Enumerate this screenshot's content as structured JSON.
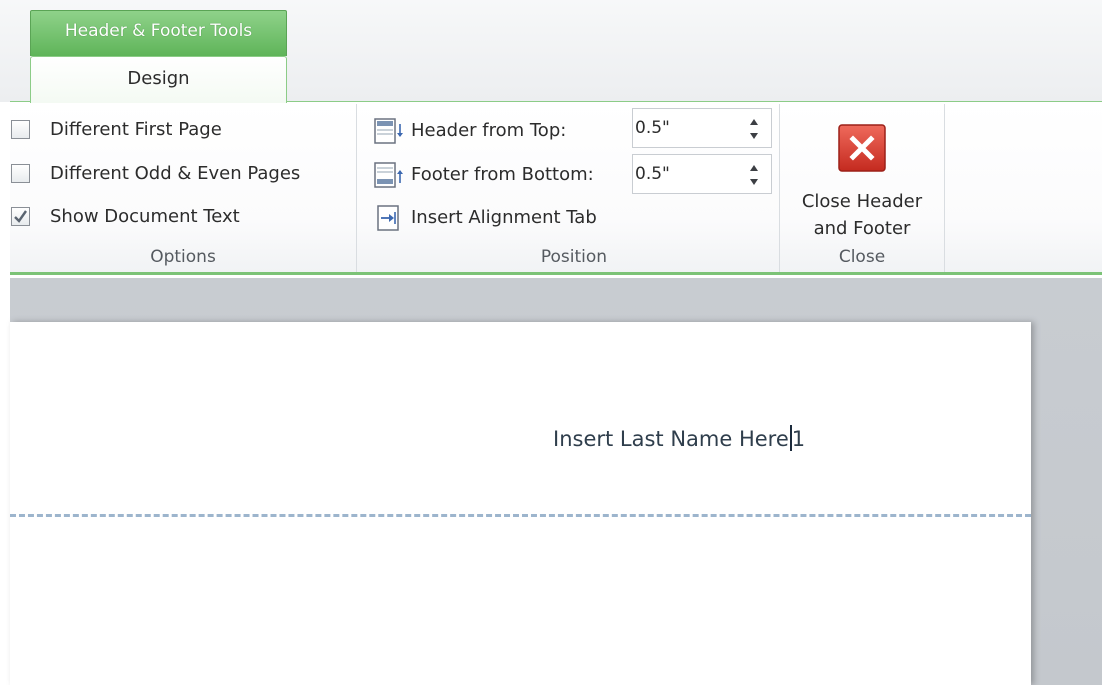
{
  "contextual_tab": {
    "title": "Header & Footer Tools"
  },
  "tabs": [
    {
      "label": "Design",
      "selected": true
    }
  ],
  "options_group": {
    "label": "Options",
    "items": [
      {
        "label": "Different First Page",
        "checked": false
      },
      {
        "label": "Different Odd & Even Pages",
        "checked": false
      },
      {
        "label": "Show Document Text",
        "checked": true
      }
    ]
  },
  "position_group": {
    "label": "Position",
    "header_from_top": {
      "label": "Header from Top:",
      "value": "0.5\""
    },
    "footer_from_bottom": {
      "label": "Footer from Bottom:",
      "value": "0.5\""
    },
    "insert_alignment_tab": {
      "label": "Insert Alignment Tab"
    }
  },
  "close_group": {
    "label": "Close",
    "close_button": {
      "line1": "Close Header",
      "line2": "and Footer"
    }
  },
  "document": {
    "header_text": "Insert Last Name Here",
    "page_number": "1"
  },
  "colors": {
    "contextual_green": "#6cbf66",
    "ribbon_border": "#7cc377",
    "close_red": "#d43a2e",
    "header_divider": "#9db5cd"
  }
}
